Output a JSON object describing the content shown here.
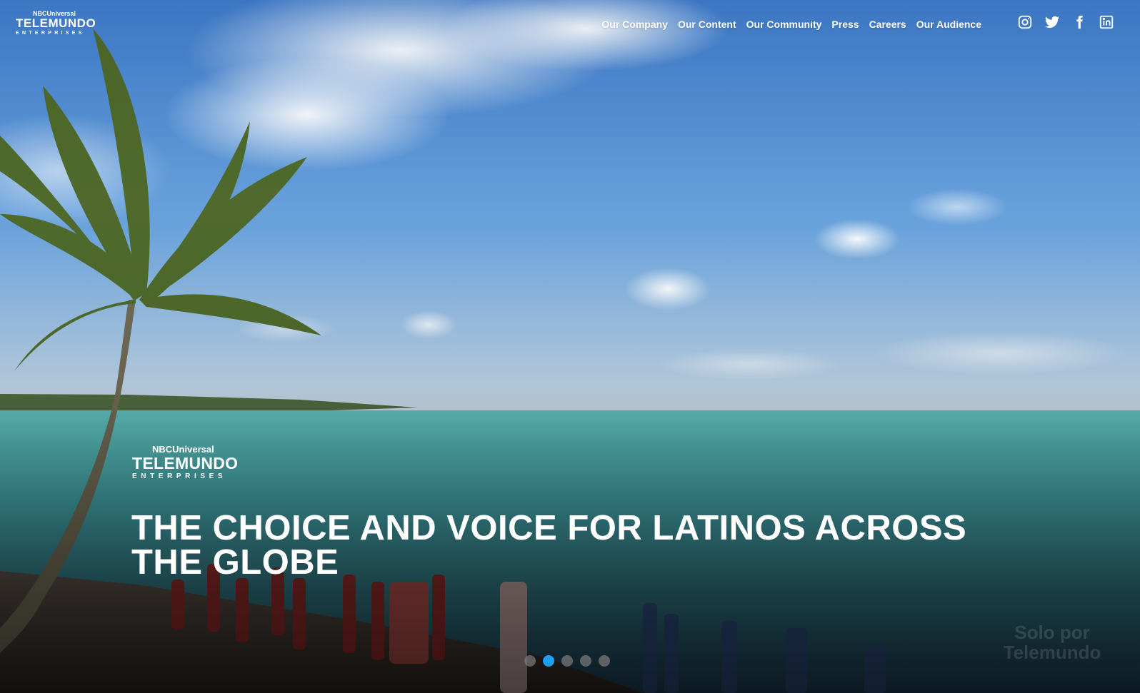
{
  "brand": {
    "top": "NBCUniversal",
    "main": "TELEMUNDO",
    "sub": "ENTERPRISES"
  },
  "nav": {
    "items": [
      {
        "label": "Our Company"
      },
      {
        "label": "Our Content"
      },
      {
        "label": "Our Community"
      },
      {
        "label": "Press"
      },
      {
        "label": "Careers"
      },
      {
        "label": "Our Audience"
      }
    ]
  },
  "social": {
    "icons": [
      "instagram-icon",
      "twitter-icon",
      "facebook-icon",
      "linkedin-icon"
    ]
  },
  "hero": {
    "logo_top": "NBCUniversal",
    "logo_main": "TELEMUNDO",
    "logo_sub": "ENTERPRISES",
    "headline": "THE CHOICE AND VOICE FOR LATINOS ACROSS THE GLOBE",
    "slides_total": 5,
    "active_slide": 2,
    "watermark": "Solo por Telemundo"
  },
  "colors": {
    "active_dot": "#1da1f2",
    "inactive_dot": "#7a7a7a",
    "text": "#ffffff"
  }
}
